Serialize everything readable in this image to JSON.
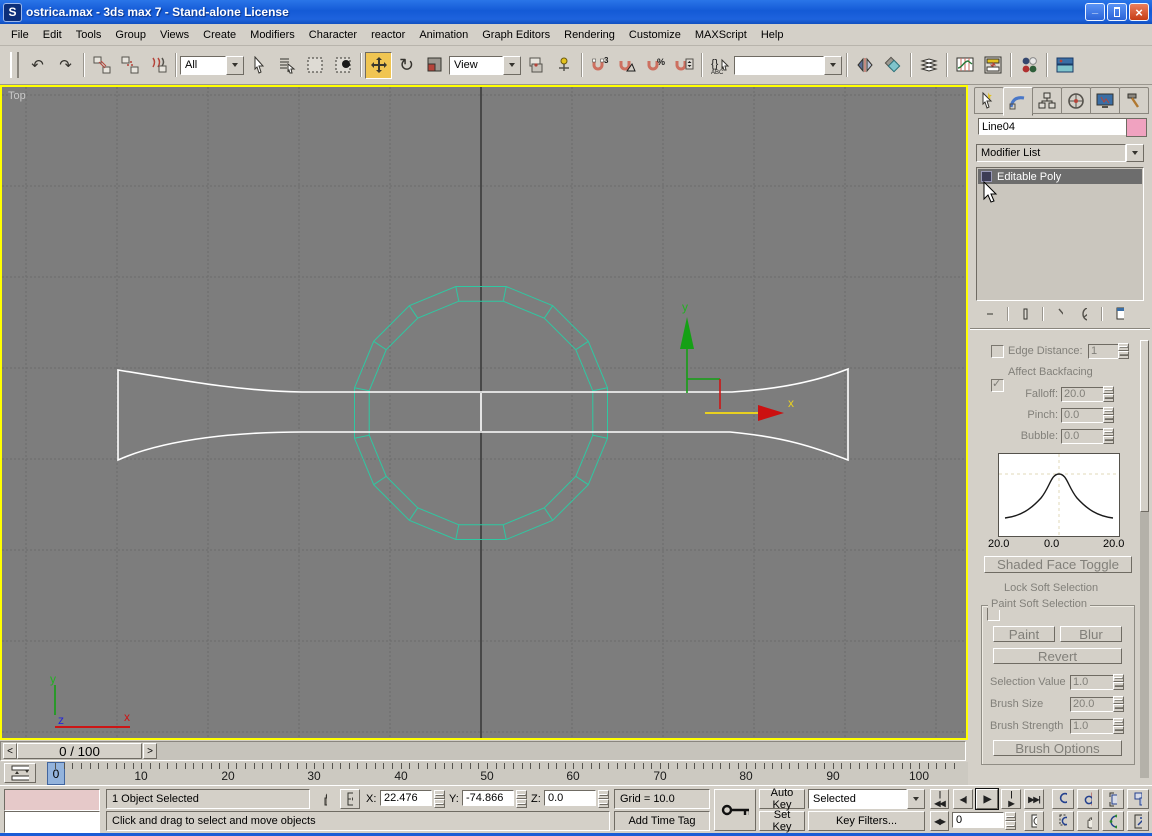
{
  "window": {
    "title": "ostrica.max - 3ds max 7  - Stand-alone License"
  },
  "menu": {
    "items": [
      "File",
      "Edit",
      "Tools",
      "Group",
      "Views",
      "Create",
      "Modifiers",
      "Character",
      "reactor",
      "Animation",
      "Graph Editors",
      "Rendering",
      "Customize",
      "MAXScript",
      "Help"
    ]
  },
  "toolbar": {
    "selection_filter": "All",
    "coord_system": "View",
    "named_sets": ""
  },
  "viewport": {
    "label": "Top",
    "gizmo": {
      "x": "x",
      "y": "y"
    },
    "tripod": {
      "x": "x",
      "y": "y",
      "z": "z"
    },
    "background": "#7d7d7d",
    "grid_color": "#6b6b6b",
    "spline_color": "#ffffff",
    "circle_color": "#2fc8a2",
    "active_border": "#ffff00"
  },
  "panel": {
    "object_name": "Line04",
    "color_swatch": "#f0a2c0",
    "modifier_list_label": "Modifier List",
    "stack_item": "Editable Poly",
    "soft": {
      "edge_distance_label": "Edge Distance:",
      "edge_distance_value": "1",
      "affect_backfacing_label": "Affect Backfacing",
      "falloff_label": "Falloff:",
      "falloff_value": "20.0",
      "pinch_label": "Pinch:",
      "pinch_value": "0.0",
      "bubble_label": "Bubble:",
      "bubble_value": "0.0",
      "curve_left": "20.0",
      "curve_mid": "0.0",
      "curve_right": "20.0",
      "shaded_face_toggle": "Shaded Face Toggle",
      "lock_label": "Lock Soft Selection",
      "paint": {
        "title": "Paint Soft Selection",
        "paint": "Paint",
        "blur": "Blur",
        "revert": "Revert",
        "selection_value_label": "Selection Value",
        "selection_value": "1.0",
        "brush_size_label": "Brush Size",
        "brush_size": "20.0",
        "brush_strength_label": "Brush Strength",
        "brush_strength": "1.0",
        "brush_options": "Brush Options"
      }
    }
  },
  "time": {
    "slider_label": "0 / 100",
    "step_back": "<",
    "step_fwd": ">",
    "tick_labels": [
      "0",
      "10",
      "20",
      "30",
      "40",
      "50",
      "60",
      "70",
      "80",
      "90",
      "100"
    ],
    "current_frame": "0"
  },
  "status": {
    "selection": "1 Object Selected",
    "prompt": "Click and drag to select and move objects",
    "x_label": "X:",
    "x_value": "22.476",
    "y_label": "Y:",
    "y_value": "-74.866",
    "z_label": "Z:",
    "z_value": "0.0",
    "grid": "Grid = 10.0",
    "add_time_tag": "Add Time Tag",
    "auto_key": "Auto Key",
    "set_key": "Set Key",
    "filter_scope": "Selected",
    "key_filters": "Key Filters..."
  },
  "icons": {
    "minimize": "_",
    "close": "×",
    "undo": "↶",
    "redo": "↷",
    "rotate": "↻",
    "goto_start": "|◀◀",
    "prev_frame": "◀|",
    "play": "▶",
    "next_frame": "|▶",
    "goto_end": "▶▶|",
    "key_mode": "◀▶"
  }
}
